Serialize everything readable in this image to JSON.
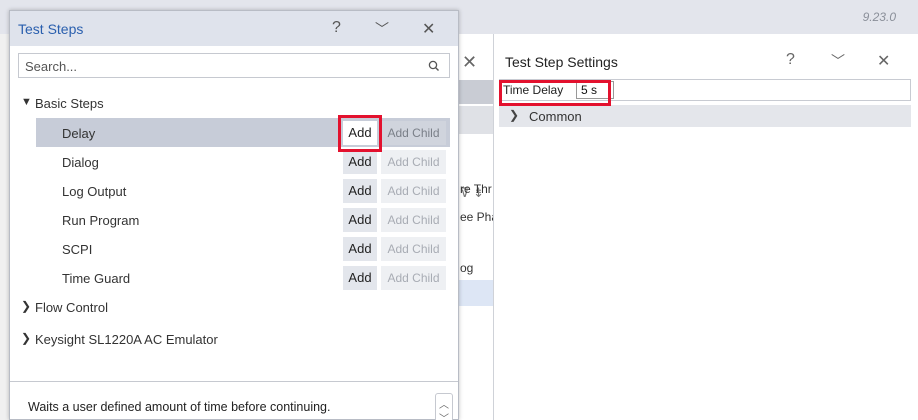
{
  "app": {
    "version": "9.23.0"
  },
  "background_panel": {
    "lines": [
      "re Thr",
      "ee Pha",
      "og"
    ]
  },
  "settings": {
    "title": "Test Step Settings",
    "help": "?",
    "collapse": "⌵",
    "close": "✕",
    "time_delay_label": "Time Delay",
    "time_delay_value": "5 s",
    "common_label": "Common"
  },
  "dialog": {
    "title": "Test Steps",
    "help": "?",
    "collapse": "⌵",
    "close": "✕",
    "search_placeholder": "Search...",
    "group_basic": "Basic Steps",
    "items": [
      {
        "label": "Delay",
        "add": "Add",
        "add_child": "Add Child",
        "selected": true
      },
      {
        "label": "Dialog",
        "add": "Add",
        "add_child": "Add Child"
      },
      {
        "label": "Log Output",
        "add": "Add",
        "add_child": "Add Child"
      },
      {
        "label": "Run Program",
        "add": "Add",
        "add_child": "Add Child"
      },
      {
        "label": "SCPI",
        "add": "Add",
        "add_child": "Add Child"
      },
      {
        "label": "Time Guard",
        "add": "Add",
        "add_child": "Add Child"
      }
    ],
    "group_flow": "Flow Control",
    "group_keysight": "Keysight SL1220A AC Emulator",
    "description": "Waits a user defined amount of time before continuing."
  },
  "colors": {
    "highlight": "#e3112e",
    "title_blue": "#2a5fae"
  }
}
